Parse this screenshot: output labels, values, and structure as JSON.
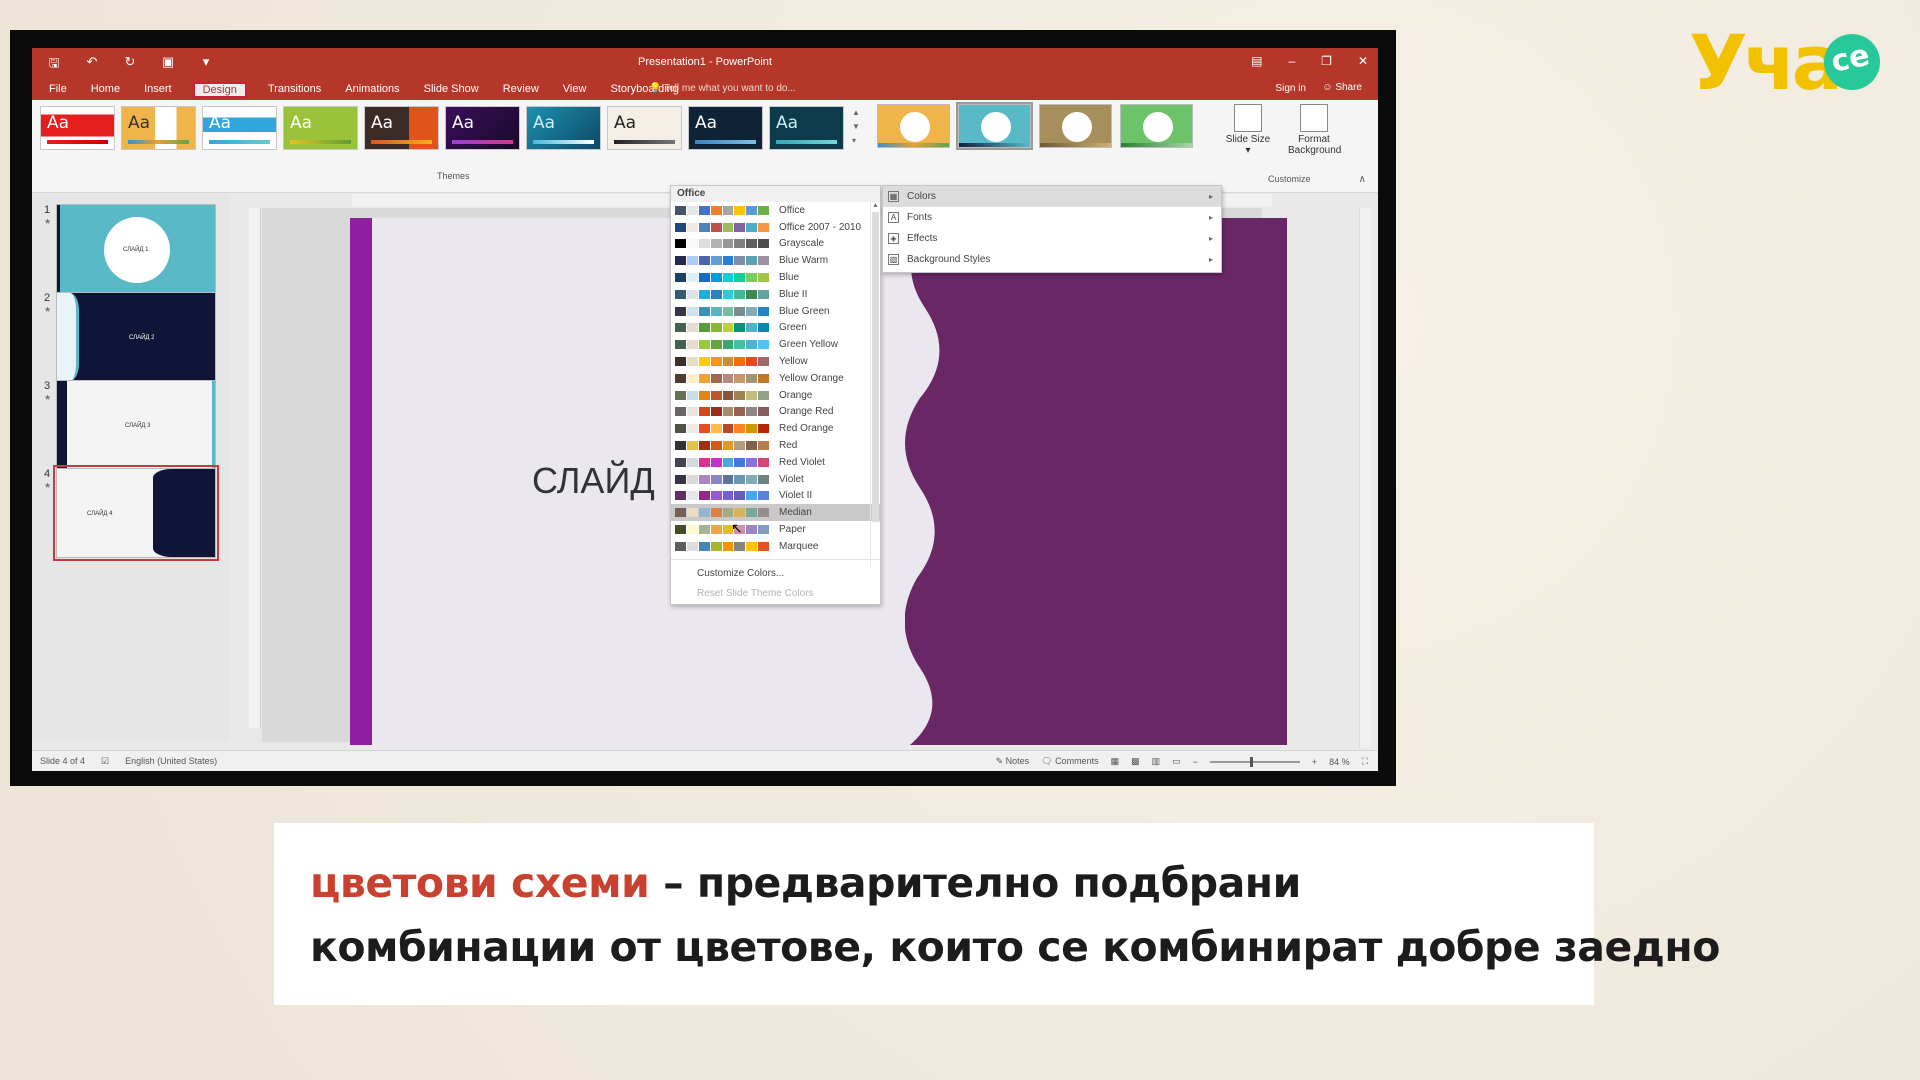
{
  "window": {
    "title": "Presentation1 - PowerPoint"
  },
  "tabs": [
    "File",
    "Home",
    "Insert",
    "Design",
    "Transitions",
    "Animations",
    "Slide Show",
    "Review",
    "View",
    "Storyboarding"
  ],
  "active_tab": "Design",
  "tell_me": "Tell me what you want to do...",
  "account": {
    "sign_in": "Sign in",
    "share": "Share"
  },
  "ribbon": {
    "themes_label": "Themes",
    "theme_sample": "Aa",
    "customize_label": "Customize",
    "slide_size": "Slide Size",
    "format_background": "Format Background"
  },
  "slides": [
    {
      "num": "1",
      "label": "СЛАЙД 1",
      "bg": "#5ab9c6"
    },
    {
      "num": "2",
      "label": "СЛАЙД 2",
      "bg": "#101436"
    },
    {
      "num": "3",
      "label": "СЛАЙД 3",
      "bg": "#f4f4f4"
    },
    {
      "num": "4",
      "label": "СЛАЙД 4",
      "bg": "#f4f4f4"
    }
  ],
  "slide_main": {
    "title": "СЛАЙД"
  },
  "colors_menu": {
    "header": "Office",
    "schemes": [
      {
        "name": "Office",
        "colors": [
          "#44546a",
          "#e7e6e6",
          "#4472c4",
          "#ed7d31",
          "#a5a5a5",
          "#ffc000",
          "#5b9bd5",
          "#70ad47"
        ]
      },
      {
        "name": "Office 2007 - 2010",
        "colors": [
          "#1f497d",
          "#eeece1",
          "#4f81bd",
          "#c0504d",
          "#9bbb59",
          "#8064a2",
          "#4bacc6",
          "#f79646"
        ]
      },
      {
        "name": "Grayscale",
        "colors": [
          "#000000",
          "#f8f8f8",
          "#dddddd",
          "#b2b2b2",
          "#969696",
          "#808080",
          "#5f5f5f",
          "#4d4d4d"
        ]
      },
      {
        "name": "Blue Warm",
        "colors": [
          "#242852",
          "#accbf9",
          "#4a66ac",
          "#629dd1",
          "#297fd5",
          "#7f8fa9",
          "#5aa2ae",
          "#9d90a0"
        ]
      },
      {
        "name": "Blue",
        "colors": [
          "#17406d",
          "#dbeff9",
          "#0f6fc6",
          "#009dd9",
          "#0bd0d9",
          "#10cf9b",
          "#7cca62",
          "#a5c249"
        ]
      },
      {
        "name": "Blue II",
        "colors": [
          "#335b74",
          "#dfe3e5",
          "#1cade4",
          "#2683c6",
          "#27ced7",
          "#42ba97",
          "#3e8853",
          "#62a39f"
        ]
      },
      {
        "name": "Blue Green",
        "colors": [
          "#373545",
          "#cee1f2",
          "#3494ba",
          "#58b6c0",
          "#75bda7",
          "#7a8c8e",
          "#84acb6",
          "#2683c6"
        ]
      },
      {
        "name": "Green",
        "colors": [
          "#455f51",
          "#e3ded1",
          "#549e39",
          "#8ab833",
          "#c0cf3a",
          "#029676",
          "#4ab5c4",
          "#0989b1"
        ]
      },
      {
        "name": "Green Yellow",
        "colors": [
          "#455f51",
          "#e3ded1",
          "#99cb38",
          "#63a537",
          "#37a76f",
          "#44c1a3",
          "#4eb3cf",
          "#51c3f9"
        ]
      },
      {
        "name": "Yellow",
        "colors": [
          "#39302a",
          "#e5dec2",
          "#ffca08",
          "#f8931d",
          "#ce8d3e",
          "#ec7016",
          "#e64823",
          "#9c6a6a"
        ]
      },
      {
        "name": "Yellow Orange",
        "colors": [
          "#4e3b30",
          "#fbeec9",
          "#f0a22e",
          "#a5644e",
          "#b58b80",
          "#c3986d",
          "#a19574",
          "#c17529"
        ]
      },
      {
        "name": "Orange",
        "colors": [
          "#637052",
          "#ccddea",
          "#e48312",
          "#bd582c",
          "#865640",
          "#9b8357",
          "#c2bc80",
          "#94a088"
        ]
      },
      {
        "name": "Orange Red",
        "colors": [
          "#696464",
          "#e9e5dc",
          "#d34817",
          "#9b2d1f",
          "#a28e6a",
          "#956251",
          "#918485",
          "#855d5d"
        ]
      },
      {
        "name": "Red Orange",
        "colors": [
          "#505046",
          "#eeece1",
          "#e84c22",
          "#ffbd47",
          "#b64926",
          "#ff8427",
          "#cc9900",
          "#b22600"
        ]
      },
      {
        "name": "Red",
        "colors": [
          "#323232",
          "#e5c243",
          "#a5300f",
          "#d55816",
          "#e19825",
          "#b19c7d",
          "#7f5f52",
          "#b27d49"
        ]
      },
      {
        "name": "Red Violet",
        "colors": [
          "#454551",
          "#d8d9dc",
          "#e32d91",
          "#c830cc",
          "#4ea6dc",
          "#4775e7",
          "#8971e1",
          "#d54773"
        ]
      },
      {
        "name": "Violet",
        "colors": [
          "#373545",
          "#dcd8dc",
          "#ad84c6",
          "#8784c7",
          "#5d739a",
          "#6997af",
          "#84acb6",
          "#6f8183"
        ]
      },
      {
        "name": "Violet II",
        "colors": [
          "#632e62",
          "#eae5eb",
          "#92278f",
          "#9b57d3",
          "#755dd9",
          "#665eb8",
          "#45a5ed",
          "#5982db"
        ]
      },
      {
        "name": "Median",
        "colors": [
          "#775f55",
          "#ebddc3",
          "#94b6d2",
          "#dd8047",
          "#a5ab81",
          "#d8b25c",
          "#7ba79d",
          "#968c8c"
        ]
      },
      {
        "name": "Paper",
        "colors": [
          "#444d26",
          "#fefac9",
          "#a5b592",
          "#f3a447",
          "#e7bc29",
          "#d092a7",
          "#9c85c0",
          "#809ec2"
        ]
      },
      {
        "name": "Marquee",
        "colors": [
          "#5e5e5e",
          "#ddddde",
          "#418ab3",
          "#a6b727",
          "#f69200",
          "#838383",
          "#fec306",
          "#df5327"
        ]
      }
    ],
    "highlighted": "Median",
    "customize": "Customize Colors...",
    "reset": "Reset Slide Theme Colors"
  },
  "variants_menu": {
    "items": [
      {
        "label": "Colors",
        "icon": "palette-icon"
      },
      {
        "label": "Fonts",
        "icon": "font-icon"
      },
      {
        "label": "Effects",
        "icon": "effects-icon"
      },
      {
        "label": "Background Styles",
        "icon": "background-icon"
      }
    ]
  },
  "statusbar": {
    "slide_info": "Slide 4 of 4",
    "language": "English (United States)",
    "notes": "Notes",
    "comments": "Comments",
    "zoom": "84 %"
  },
  "logo": {
    "text": "Уча",
    "bubble": "се"
  },
  "caption": {
    "term": "цветови схеми",
    "line1_rest": " – предварително подбрани",
    "line2": "комбинации от цветове, които се комбинират добре заедно"
  },
  "colors": {
    "titlebar": "#b5372a",
    "accent_purple": "#6a2766",
    "accent_magenta": "#8e1fa1",
    "caption_term": "#c9422f"
  }
}
